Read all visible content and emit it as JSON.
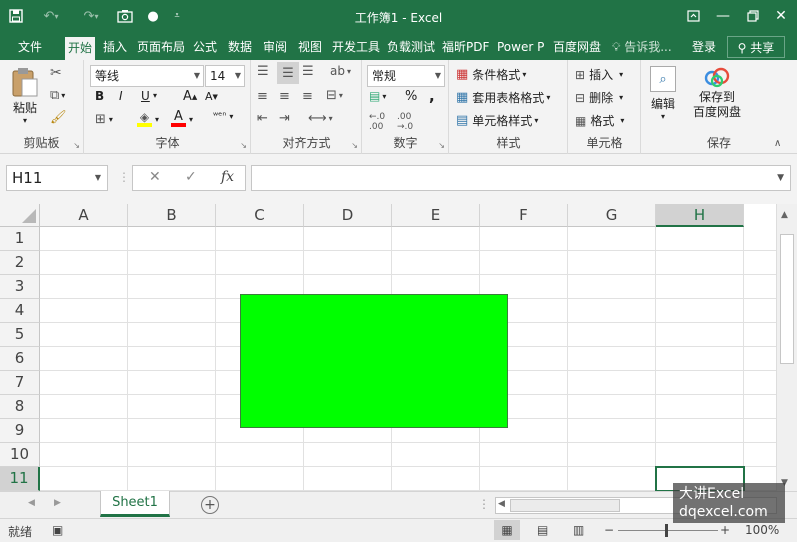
{
  "window": {
    "title": "工作簿1 - Excel",
    "accent": "#217346"
  },
  "tabs": {
    "file": "文件",
    "home": "开始",
    "insert": "插入",
    "layout": "页面布局",
    "formulas": "公式",
    "data": "数据",
    "review": "审阅",
    "view": "视图",
    "developer": "开发工具",
    "loadtest": "负载测试",
    "foxit": "福昕PDF",
    "powerp": "Power P",
    "baidu": "百度网盘",
    "tellme": "告诉我...",
    "login": "登录",
    "share": "共享"
  },
  "ribbon": {
    "clipboard": {
      "paste": "粘贴",
      "label": "剪贴板"
    },
    "font": {
      "font_name": "等线",
      "font_size": "14",
      "label": "字体",
      "bold": "B",
      "italic": "I",
      "underline": "U"
    },
    "alignment": {
      "label": "对齐方式"
    },
    "number": {
      "format": "常规",
      "label": "数字",
      "percent": "%",
      "comma": ","
    },
    "styles": {
      "conditional": "条件格式",
      "table": "套用表格格式",
      "cell_styles": "单元格样式",
      "label": "样式"
    },
    "cells": {
      "insert": "插入",
      "delete": "删除",
      "format": "格式",
      "label": "单元格"
    },
    "editing": {
      "label": "编辑"
    },
    "save": {
      "line1": "保存到",
      "line2": "百度网盘",
      "label": "保存"
    }
  },
  "formula_bar": {
    "name_box": "H11",
    "fx": "fx",
    "content": ""
  },
  "grid": {
    "columns": [
      "A",
      "B",
      "C",
      "D",
      "E",
      "F",
      "G",
      "H"
    ],
    "rows": [
      "1",
      "2",
      "3",
      "4",
      "5",
      "6",
      "7",
      "8",
      "9",
      "10",
      "11"
    ],
    "shape_fill": "#00ff00"
  },
  "sheets": {
    "active": "Sheet1"
  },
  "status": {
    "ready": "就绪",
    "zoom": "100%"
  },
  "watermark": {
    "line1": "大讲Excel",
    "line2": "dqexcel.com"
  }
}
